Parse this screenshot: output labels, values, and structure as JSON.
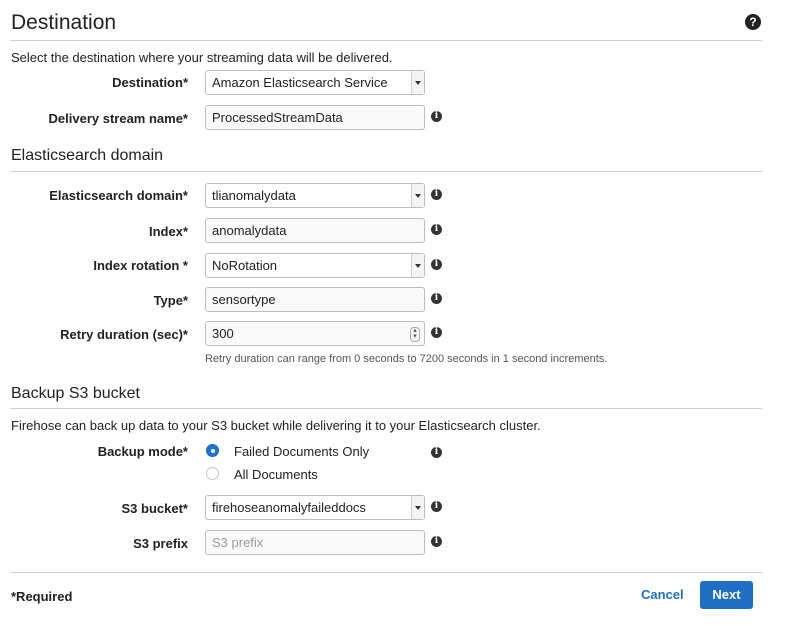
{
  "header": {
    "title": "Destination",
    "help_icon": "question-circle-icon"
  },
  "destination": {
    "description": "Select the destination where your streaming data will be delivered.",
    "destination_label": "Destination*",
    "destination_value": "Amazon Elasticsearch Service",
    "stream_name_label": "Delivery stream name*",
    "stream_name_value": "ProcessedStreamData"
  },
  "es": {
    "title": "Elasticsearch domain",
    "domain_label": "Elasticsearch domain*",
    "domain_value": "tlianomalydata",
    "index_label": "Index*",
    "index_value": "anomalydata",
    "rotation_label": "Index rotation *",
    "rotation_value": "NoRotation",
    "type_label": "Type*",
    "type_value": "sensortype",
    "retry_label": "Retry duration (sec)*",
    "retry_value": "300",
    "retry_hint": "Retry duration can range from 0 seconds to 7200 seconds in 1 second increments."
  },
  "backup": {
    "title": "Backup S3 bucket",
    "description": "Firehose can back up data to your S3 bucket while delivering it to your Elasticsearch cluster.",
    "mode_label": "Backup mode*",
    "option_failed": "Failed Documents Only",
    "option_all": "All Documents",
    "selected": "Failed Documents Only",
    "bucket_label": "S3 bucket*",
    "bucket_value": "firehoseanomalyfaileddocs",
    "prefix_label": "S3 prefix",
    "prefix_placeholder": "S3 prefix"
  },
  "footer": {
    "required": "*Required",
    "cancel": "Cancel",
    "next": "Next"
  },
  "colors": {
    "primary": "#1f6fc5",
    "radio_selected": "#1e73d8"
  }
}
